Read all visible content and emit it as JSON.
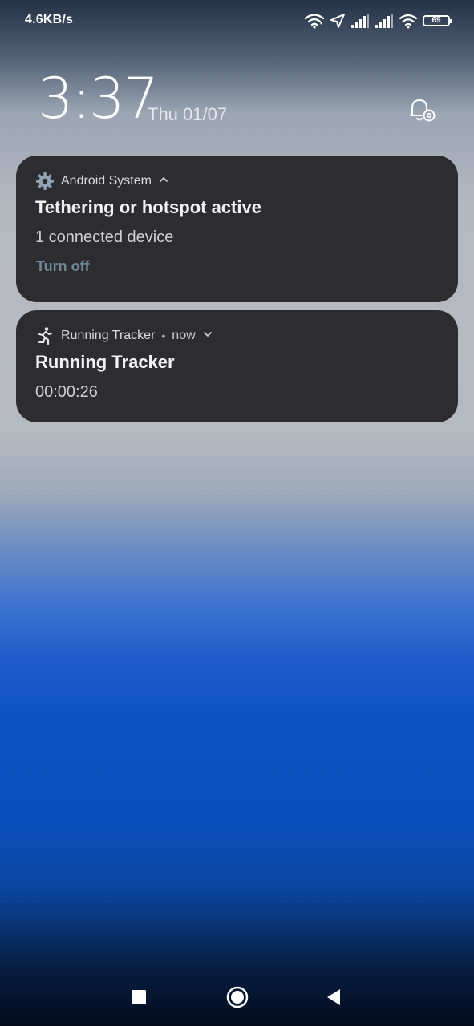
{
  "status_bar": {
    "net_speed": "4.6KB/s",
    "battery_level": "69",
    "icons": [
      "wifi-icon",
      "location-arrow-icon",
      "signal-strength-icon",
      "signal-strength-icon",
      "wifi-secondary-icon",
      "battery-icon"
    ]
  },
  "lockscreen": {
    "time": "3:37",
    "date": "Thu 01/07",
    "settings_icon": "notification-settings-icon"
  },
  "notifications": [
    {
      "app_name": "Android System",
      "app_icon": "gear-icon",
      "expand_icon": "chevron-up-icon",
      "title": "Tethering or hotspot active",
      "text": "1 connected device",
      "action": "Turn off"
    },
    {
      "app_name": "Running Tracker",
      "app_icon": "running-person-icon",
      "separator": "•",
      "time": "now",
      "expand_icon": "chevron-down-icon",
      "title": "Running Tracker",
      "text": "00:00:26"
    }
  ],
  "navigation": {
    "buttons": [
      "recents-icon",
      "home-icon",
      "back-icon"
    ]
  },
  "colors": {
    "card_background": "#2d2d2f",
    "action_text": "#6e8799",
    "wallpaper_top": "#233247",
    "wallpaper_mid": "#b7bbc0",
    "wallpaper_blue": "#0a4fba"
  }
}
